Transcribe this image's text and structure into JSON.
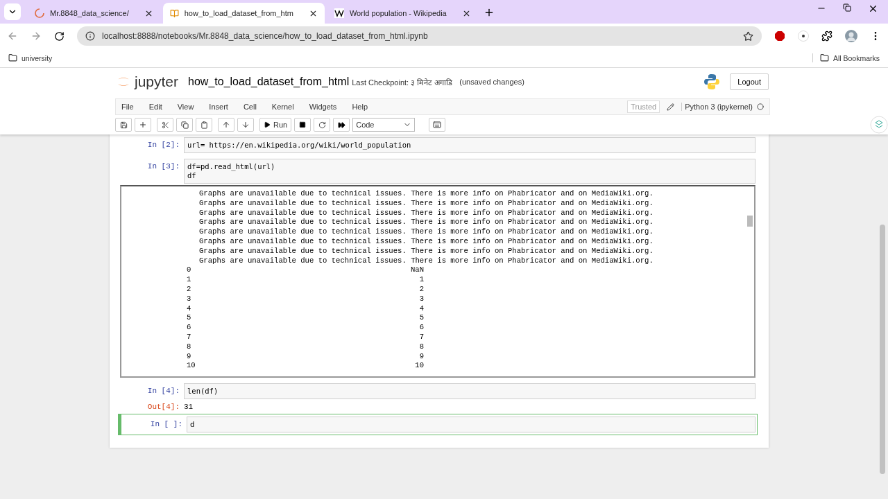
{
  "browser": {
    "tabs": [
      {
        "title": "Mr.8848_data_science/",
        "selected": false
      },
      {
        "title": "how_to_load_dataset_from_htm",
        "selected": true
      },
      {
        "title": "World population - Wikipedia",
        "selected": false
      }
    ],
    "url": "localhost:8888/notebooks/Mr.8848_data_science/how_to_load_dataset_from_html.ipynb",
    "bookmarks": [
      "university"
    ],
    "all_bookmarks": "All Bookmarks"
  },
  "jupyter": {
    "logo_text": "jupyter",
    "notebook_name": "how_to_load_dataset_from_html",
    "checkpoint": "Last Checkpoint: ३ मिनेट अगाडि",
    "status": "(unsaved changes)",
    "logout": "Logout",
    "menu": [
      "File",
      "Edit",
      "View",
      "Insert",
      "Cell",
      "Kernel",
      "Widgets",
      "Help"
    ],
    "run_label": "Run",
    "cell_type": "Code",
    "trusted": "Trusted",
    "kernel": "Python 3 (ipykernel)"
  },
  "cells": [
    {
      "prompt": "In [2]:",
      "code": [
        "url= https://en.wikipedia.org/wiki/world_population"
      ],
      "selected": false
    },
    {
      "prompt": "In [3]:",
      "code": [
        "df=pd.read_html(url)",
        "df"
      ],
      "selected": false,
      "output": {
        "kind": "frame",
        "lines": [
          "Graphs are unavailable due to technical issues. There is more info on Phabricator and on MediaWiki.org.",
          "Graphs are unavailable due to technical issues. There is more info on Phabricator and on MediaWiki.org.",
          "Graphs are unavailable due to technical issues. There is more info on Phabricator and on MediaWiki.org.",
          "Graphs are unavailable due to technical issues. There is more info on Phabricator and on MediaWiki.org.",
          "Graphs are unavailable due to technical issues. There is more info on Phabricator and on MediaWiki.org.",
          "Graphs are unavailable due to technical issues. There is more info on Phabricator and on MediaWiki.org.",
          "Graphs are unavailable due to technical issues. There is more info on Phabricator and on MediaWiki.org.",
          "Graphs are unavailable due to technical issues. There is more info on Phabricator and on MediaWiki.org."
        ],
        "rows": [
          [
            "0",
            "NaN"
          ],
          [
            "1",
            "1"
          ],
          [
            "2",
            "2"
          ],
          [
            "3",
            "3"
          ],
          [
            "4",
            "4"
          ],
          [
            "5",
            "5"
          ],
          [
            "6",
            "6"
          ],
          [
            "7",
            "7"
          ],
          [
            "8",
            "8"
          ],
          [
            "9",
            "9"
          ],
          [
            "10",
            "10"
          ]
        ]
      }
    },
    {
      "prompt": "In [4]:",
      "code": [
        "len(df)"
      ],
      "selected": false,
      "output": {
        "kind": "text",
        "prompt": "Out[4]:",
        "value": "31"
      }
    },
    {
      "prompt": "In [ ]:",
      "code": [
        "d"
      ],
      "selected": true
    }
  ]
}
